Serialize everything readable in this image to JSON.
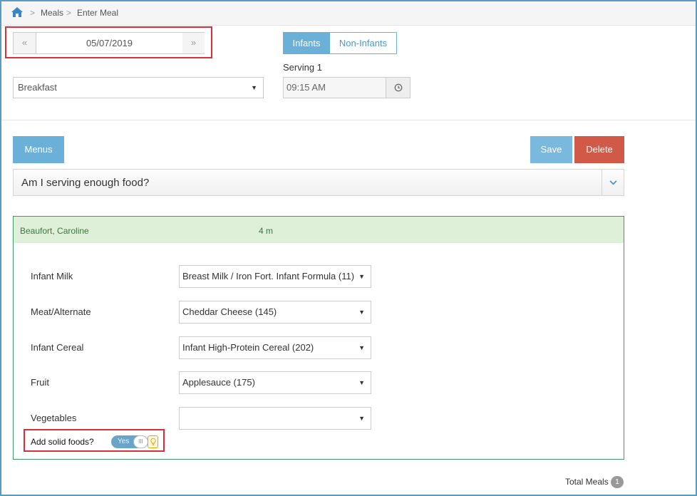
{
  "breadcrumb": {
    "home_icon": "home-icon",
    "items": [
      "Meals",
      "Enter Meal"
    ],
    "separator": ">"
  },
  "date_nav": {
    "prev_label": "«",
    "next_label": "»",
    "date": "05/07/2019"
  },
  "tabs": {
    "infants": "Infants",
    "non_infants": "Non-Infants",
    "active": "Infants"
  },
  "meal_select": {
    "value": "Breakfast"
  },
  "serving": {
    "label": "Serving 1",
    "time": "09:15 AM",
    "clock_icon": "clock-icon"
  },
  "buttons": {
    "menus": "Menus",
    "save": "Save",
    "delete": "Delete"
  },
  "accordion": {
    "title": "Am I serving enough food?",
    "toggle_icon": "chevron-down-icon"
  },
  "child": {
    "name": "Beaufort, Caroline",
    "age": "4 m"
  },
  "food_rows": [
    {
      "label": "Infant Milk",
      "value": "Breast Milk / Iron Fort. Infant Formula (11)"
    },
    {
      "label": "Meat/Alternate",
      "value": "Cheddar Cheese (145)"
    },
    {
      "label": "Infant Cereal",
      "value": "Infant High-Protein Cereal (202)"
    },
    {
      "label": "Fruit",
      "value": "Applesauce (175)"
    },
    {
      "label": "Vegetables",
      "value": ""
    }
  ],
  "solid_foods": {
    "label": "Add solid foods?",
    "toggle_text": "Yes",
    "knob_text": "III",
    "enabled": true,
    "hint_icon": "lightbulb-icon"
  },
  "totals": {
    "label": "Total Meals",
    "count": "1"
  },
  "colors": {
    "primary": "#6bb0d8",
    "danger": "#d05a47",
    "success_bg": "#dff0d8",
    "success_text": "#3c763d",
    "highlight": "#d6303b"
  }
}
